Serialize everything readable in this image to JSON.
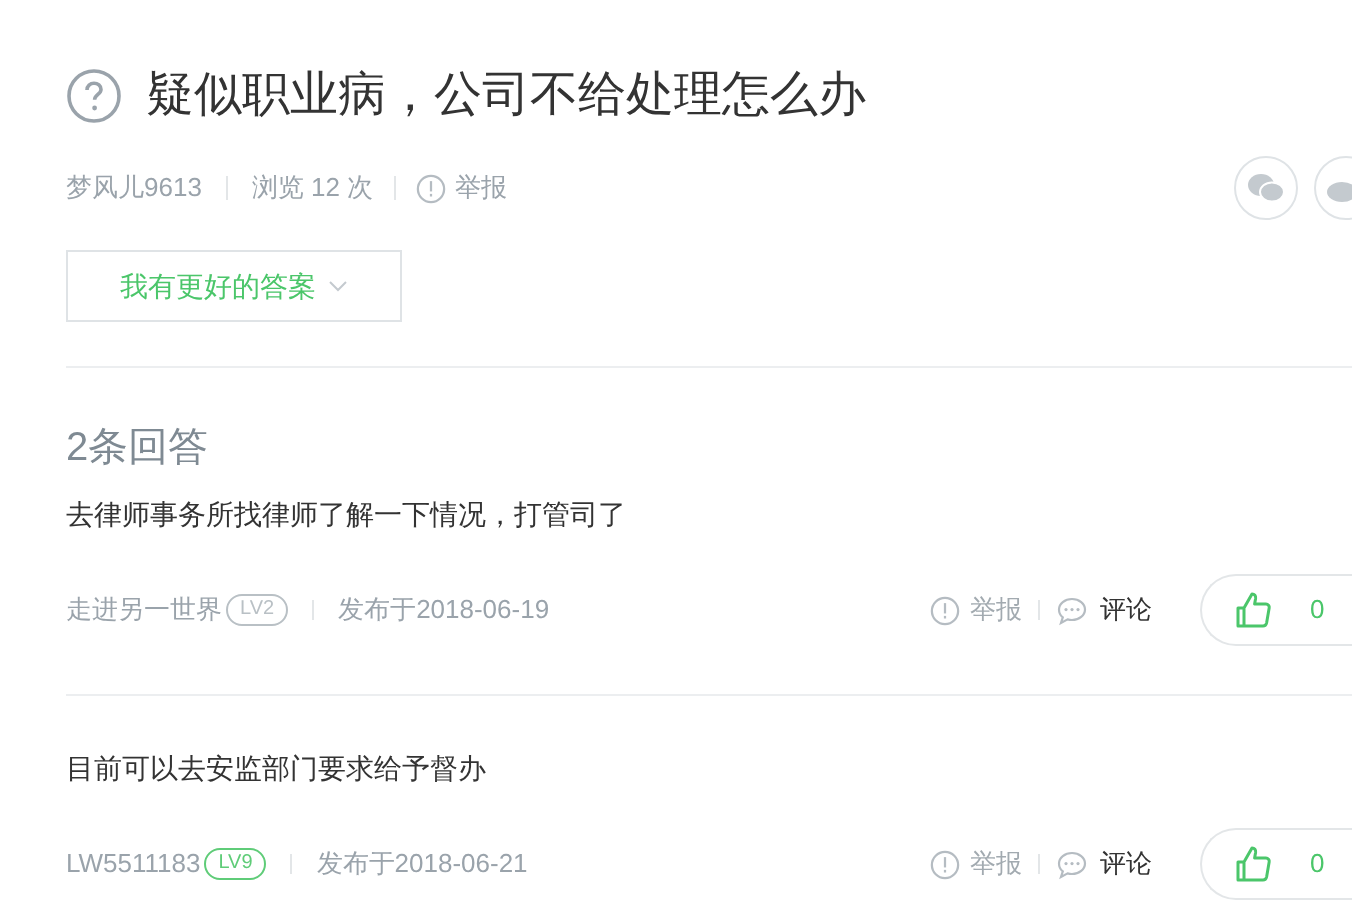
{
  "question": {
    "title": "疑似职业病，公司不给处理怎么办",
    "author": "梦风儿9613",
    "views": "浏览 12 次",
    "report": "举报"
  },
  "better_answer_button": "我有更好的答案",
  "answers_heading": "2条回答",
  "answers": [
    {
      "text": "去律师事务所找律师了解一下情况，打管司了",
      "author": "走进另一世界",
      "level": "LV2",
      "color": "#b9c0c5",
      "date": "发布于2018-06-19",
      "report": "举报",
      "comment": "评论",
      "likes": "0"
    },
    {
      "text": "目前可以去安监部门要求给予督办",
      "author": "LW5511183",
      "level": "LV9",
      "color": "#5fcc78",
      "date": "发布于2018-06-21",
      "report": "举报",
      "comment": "评论",
      "likes": "0"
    }
  ]
}
